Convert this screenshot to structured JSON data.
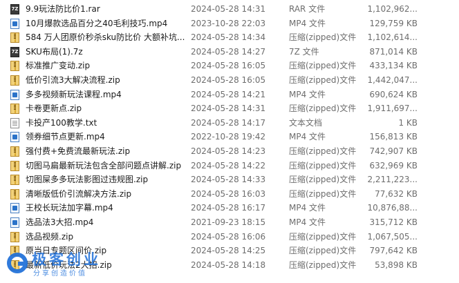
{
  "files": [
    {
      "name": "9.9玩法防比价1.rar",
      "date": "2024-05-28 14:31",
      "type": "RAR 文件",
      "size": "1,102,962...",
      "icon": "rar-archive-icon"
    },
    {
      "name": "10月爆款选品百分之40毛利技巧.mp4",
      "date": "2023-10-28 22:03",
      "type": "MP4 文件",
      "size": "129,759 KB",
      "icon": "video-file-icon"
    },
    {
      "name": "584 万人团原价秒杀sku防比价 大额补坑...",
      "date": "2024-05-28 14:34",
      "type": "压缩(zipped)文件",
      "size": "1,102,614...",
      "icon": "zip-archive-icon"
    },
    {
      "name": "SKU布局(1).7z",
      "date": "2024-05-28 14:27",
      "type": "7Z 文件",
      "size": "871,014 KB",
      "icon": "7z-archive-icon"
    },
    {
      "name": "标准推广变动.zip",
      "date": "2024-05-28 16:05",
      "type": "压缩(zipped)文件",
      "size": "433,134 KB",
      "icon": "zip-archive-icon"
    },
    {
      "name": "低价引流3大解决流程.zip",
      "date": "2024-05-28 16:05",
      "type": "压缩(zipped)文件",
      "size": "1,442,047...",
      "icon": "zip-archive-icon"
    },
    {
      "name": "多多视频新玩法课程.mp4",
      "date": "2024-05-28 14:21",
      "type": "MP4 文件",
      "size": "690,624 KB",
      "icon": "video-file-icon"
    },
    {
      "name": "卡卷更新点.zip",
      "date": "2024-05-28 14:31",
      "type": "压缩(zipped)文件",
      "size": "1,911,697...",
      "icon": "zip-archive-icon"
    },
    {
      "name": "卡投产100教学.txt",
      "date": "2024-05-28 14:17",
      "type": "文本文档",
      "size": "1 KB",
      "icon": "text-file-icon"
    },
    {
      "name": "领券细节点更新.mp4",
      "date": "2022-10-28 19:42",
      "type": "MP4 文件",
      "size": "156,813 KB",
      "icon": "video-file-icon"
    },
    {
      "name": "强付费+免费流最新玩法.zip",
      "date": "2024-05-28 14:23",
      "type": "压缩(zipped)文件",
      "size": "742,907 KB",
      "icon": "zip-archive-icon"
    },
    {
      "name": "切图马扁最新玩法包含全部问题点讲解.zip",
      "date": "2024-05-28 14:22",
      "type": "压缩(zipped)文件",
      "size": "632,969 KB",
      "icon": "zip-archive-icon"
    },
    {
      "name": "切图屎多多玩法影图过违规图.zip",
      "date": "2024-05-28 14:33",
      "type": "压缩(zipped)文件",
      "size": "2,211,223...",
      "icon": "zip-archive-icon"
    },
    {
      "name": "清晰版低价引流解决方法.zip",
      "date": "2024-05-28 16:03",
      "type": "压缩(zipped)文件",
      "size": "77,632 KB",
      "icon": "zip-archive-icon"
    },
    {
      "name": "王校长玩法加字幕.mp4",
      "date": "2024-05-28 16:17",
      "type": "MP4 文件",
      "size": "10,876,88...",
      "icon": "video-file-icon"
    },
    {
      "name": "选品法3大招.mp4",
      "date": "2021-09-23 18:15",
      "type": "MP4 文件",
      "size": "315,712 KB",
      "icon": "video-file-icon"
    },
    {
      "name": "选品视频.zip",
      "date": "2024-05-28 16:06",
      "type": "压缩(zipped)文件",
      "size": "1,067,505...",
      "icon": "zip-archive-icon"
    },
    {
      "name": "原当日专题区间价.zip",
      "date": "2024-05-28 14:25",
      "type": "压缩(zipped)文件",
      "size": "797,642 KB",
      "icon": "zip-archive-icon"
    },
    {
      "name": "最新低价玩法2大招.zip",
      "date": "2024-05-28 14:18",
      "type": "压缩(zipped)文件",
      "size": "53,898 KB",
      "icon": "zip-archive-icon"
    }
  ],
  "watermark": {
    "title": "极客创业",
    "subtitle": "分享创造价值"
  },
  "colors": {
    "text_primary": "#1a1a1a",
    "text_secondary": "#6d6d6d",
    "watermark_blue": "#1e6fd9",
    "zip_gold": "#d9a931",
    "video_blue": "#2b73c9"
  }
}
